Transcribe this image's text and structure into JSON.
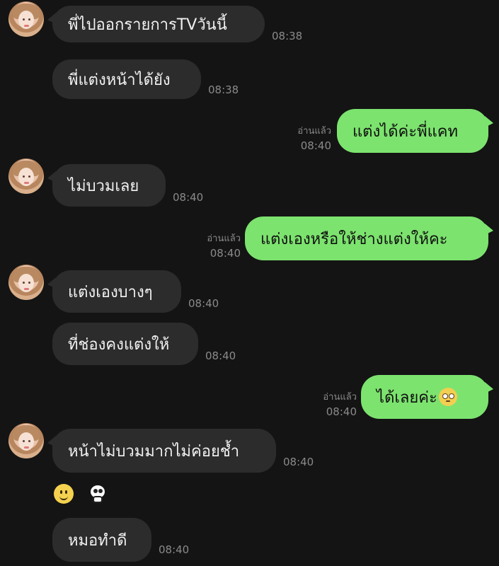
{
  "messages": [
    {
      "id": "m1",
      "dir": "in",
      "text": "พี่ไปออกรายการTVวันนี้",
      "time": "08:38"
    },
    {
      "id": "m2",
      "dir": "in",
      "text": "พี่แต่งหน้าได้ยัง",
      "time": "08:38"
    },
    {
      "id": "m3",
      "dir": "out",
      "text": "แต่งได้ค่ะพี่แคท",
      "read": "อ่านแล้ว",
      "time": "08:40"
    },
    {
      "id": "m4",
      "dir": "in",
      "text": "ไม่บวมเลย",
      "time": "08:40"
    },
    {
      "id": "m5",
      "dir": "out",
      "text": "แต่งเองหรือให้ช่างแต่งให้คะ",
      "read": "อ่านแล้ว",
      "time": "08:40"
    },
    {
      "id": "m6",
      "dir": "in",
      "text": "แต่งเองบางๆ",
      "time": "08:40"
    },
    {
      "id": "m7",
      "dir": "in",
      "text": "ที่ช่องคงแต่งให้",
      "time": "08:40"
    },
    {
      "id": "m8",
      "dir": "out",
      "text": "ได้เลยค่ะ",
      "emoji": "pleading-face-icon",
      "read": "อ่านแล้ว",
      "time": "08:40"
    },
    {
      "id": "m9",
      "dir": "in",
      "text": "หน้าไม่บวมมากไม่ค่อยช้ำ",
      "time": "08:40"
    },
    {
      "id": "m10",
      "dir": "in",
      "text": "หมอทำดี",
      "time": "08:40"
    }
  ],
  "stickers": [
    "smiley-emoji-icon",
    "panda-emoji-icon"
  ],
  "colors": {
    "background": "#141414",
    "incoming_bubble": "#2c2c2c",
    "outgoing_bubble": "#7ce36e",
    "meta_text": "#8a8a8a"
  }
}
